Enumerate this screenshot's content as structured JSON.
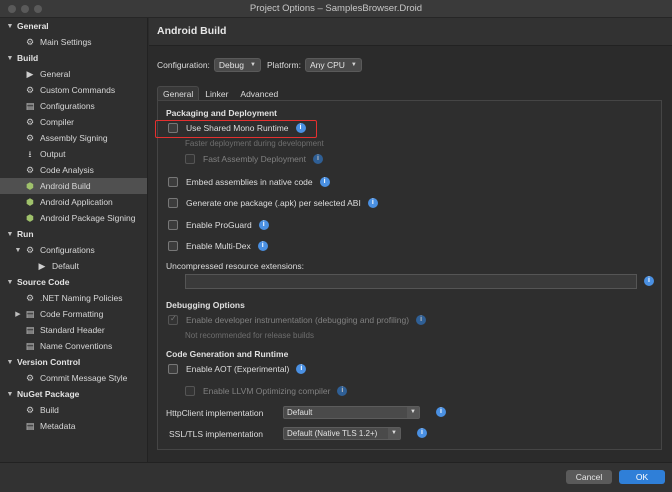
{
  "window": {
    "title": "Project Options – SamplesBrowser.Droid"
  },
  "sidebar": {
    "items": [
      {
        "label": "General",
        "kind": "group",
        "expanded": true
      },
      {
        "label": "Main Settings",
        "kind": "item",
        "icon": "gear-icon"
      },
      {
        "label": "Build",
        "kind": "group",
        "expanded": true
      },
      {
        "label": "General",
        "kind": "item",
        "icon": "play-icon"
      },
      {
        "label": "Custom Commands",
        "kind": "item",
        "icon": "gear-icon"
      },
      {
        "label": "Configurations",
        "kind": "item",
        "icon": "document-icon"
      },
      {
        "label": "Compiler",
        "kind": "item",
        "icon": "gear-icon"
      },
      {
        "label": "Assembly Signing",
        "kind": "item",
        "icon": "gear-icon"
      },
      {
        "label": "Output",
        "kind": "item",
        "icon": "output-icon"
      },
      {
        "label": "Code Analysis",
        "kind": "item",
        "icon": "gear-icon"
      },
      {
        "label": "Android Build",
        "kind": "item",
        "icon": "android-icon",
        "selected": true
      },
      {
        "label": "Android Application",
        "kind": "item",
        "icon": "android-icon"
      },
      {
        "label": "Android Package Signing",
        "kind": "item",
        "icon": "android-icon"
      },
      {
        "label": "Run",
        "kind": "group",
        "expanded": true
      },
      {
        "label": "Configurations",
        "kind": "subgroup",
        "icon": "gear-icon"
      },
      {
        "label": "Default",
        "kind": "subitem",
        "icon": "play-icon"
      },
      {
        "label": "Source Code",
        "kind": "group",
        "expanded": true
      },
      {
        "label": ".NET Naming Policies",
        "kind": "item",
        "icon": "gear-icon"
      },
      {
        "label": "Code Formatting",
        "kind": "item-collapsed",
        "icon": "document-icon"
      },
      {
        "label": "Standard Header",
        "kind": "item",
        "icon": "document-icon"
      },
      {
        "label": "Name Conventions",
        "kind": "item",
        "icon": "document-icon"
      },
      {
        "label": "Version Control",
        "kind": "group",
        "expanded": true
      },
      {
        "label": "Commit Message Style",
        "kind": "item",
        "icon": "gear-icon"
      },
      {
        "label": "NuGet Package",
        "kind": "group",
        "expanded": true
      },
      {
        "label": "Build",
        "kind": "item",
        "icon": "gear-icon"
      },
      {
        "label": "Metadata",
        "kind": "item",
        "icon": "document-icon"
      }
    ]
  },
  "main": {
    "header": "Android Build",
    "configuration_label": "Configuration:",
    "configuration_value": "Debug",
    "platform_label": "Platform:",
    "platform_value": "Any CPU",
    "tabs": [
      {
        "label": "General",
        "active": true
      },
      {
        "label": "Linker",
        "active": false
      },
      {
        "label": "Advanced",
        "active": false
      }
    ],
    "packaging": {
      "title": "Packaging and Deployment",
      "shared_runtime": "Use Shared Mono Runtime",
      "shared_runtime_sub": "Faster deployment during development",
      "fast_assembly": "Fast Assembly Deployment",
      "embed": "Embed assemblies in native code",
      "per_abi": "Generate one package (.apk) per selected ABI",
      "proguard": "Enable ProGuard",
      "multidex": "Enable Multi-Dex",
      "uncompressed_label": "Uncompressed resource extensions:",
      "uncompressed_value": ""
    },
    "debugging": {
      "title": "Debugging Options",
      "instrumentation": "Enable developer instrumentation (debugging and profiling)",
      "instrumentation_sub": "Not recommended for release builds"
    },
    "codegen": {
      "title": "Code Generation and Runtime",
      "aot": "Enable AOT (Experimental)",
      "llvm": "Enable LLVM Optimizing compiler",
      "httpclient_label": "HttpClient implementation",
      "httpclient_value": "Default",
      "ssl_label": "SSL/TLS implementation",
      "ssl_value": "Default (Native TLS 1.2+)"
    }
  },
  "footer": {
    "cancel": "Cancel",
    "ok": "OK"
  },
  "colors": {
    "accent": "#2f7fd8",
    "info": "#4a90e2",
    "highlight": "#e5302f",
    "selected": "#505050"
  }
}
